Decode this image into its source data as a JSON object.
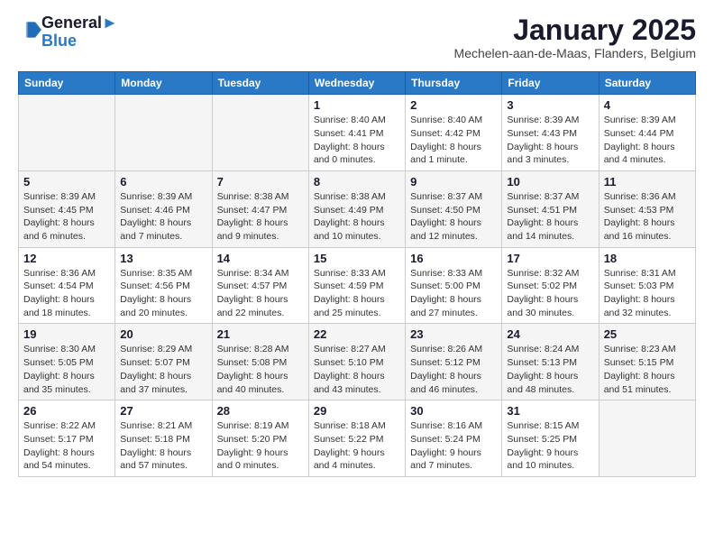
{
  "header": {
    "logo_line1": "General",
    "logo_line2": "Blue",
    "title": "January 2025",
    "subtitle": "Mechelen-aan-de-Maas, Flanders, Belgium"
  },
  "columns": [
    "Sunday",
    "Monday",
    "Tuesday",
    "Wednesday",
    "Thursday",
    "Friday",
    "Saturday"
  ],
  "weeks": [
    [
      {
        "day": "",
        "info": ""
      },
      {
        "day": "",
        "info": ""
      },
      {
        "day": "",
        "info": ""
      },
      {
        "day": "1",
        "info": "Sunrise: 8:40 AM\nSunset: 4:41 PM\nDaylight: 8 hours\nand 0 minutes."
      },
      {
        "day": "2",
        "info": "Sunrise: 8:40 AM\nSunset: 4:42 PM\nDaylight: 8 hours\nand 1 minute."
      },
      {
        "day": "3",
        "info": "Sunrise: 8:39 AM\nSunset: 4:43 PM\nDaylight: 8 hours\nand 3 minutes."
      },
      {
        "day": "4",
        "info": "Sunrise: 8:39 AM\nSunset: 4:44 PM\nDaylight: 8 hours\nand 4 minutes."
      }
    ],
    [
      {
        "day": "5",
        "info": "Sunrise: 8:39 AM\nSunset: 4:45 PM\nDaylight: 8 hours\nand 6 minutes."
      },
      {
        "day": "6",
        "info": "Sunrise: 8:39 AM\nSunset: 4:46 PM\nDaylight: 8 hours\nand 7 minutes."
      },
      {
        "day": "7",
        "info": "Sunrise: 8:38 AM\nSunset: 4:47 PM\nDaylight: 8 hours\nand 9 minutes."
      },
      {
        "day": "8",
        "info": "Sunrise: 8:38 AM\nSunset: 4:49 PM\nDaylight: 8 hours\nand 10 minutes."
      },
      {
        "day": "9",
        "info": "Sunrise: 8:37 AM\nSunset: 4:50 PM\nDaylight: 8 hours\nand 12 minutes."
      },
      {
        "day": "10",
        "info": "Sunrise: 8:37 AM\nSunset: 4:51 PM\nDaylight: 8 hours\nand 14 minutes."
      },
      {
        "day": "11",
        "info": "Sunrise: 8:36 AM\nSunset: 4:53 PM\nDaylight: 8 hours\nand 16 minutes."
      }
    ],
    [
      {
        "day": "12",
        "info": "Sunrise: 8:36 AM\nSunset: 4:54 PM\nDaylight: 8 hours\nand 18 minutes."
      },
      {
        "day": "13",
        "info": "Sunrise: 8:35 AM\nSunset: 4:56 PM\nDaylight: 8 hours\nand 20 minutes."
      },
      {
        "day": "14",
        "info": "Sunrise: 8:34 AM\nSunset: 4:57 PM\nDaylight: 8 hours\nand 22 minutes."
      },
      {
        "day": "15",
        "info": "Sunrise: 8:33 AM\nSunset: 4:59 PM\nDaylight: 8 hours\nand 25 minutes."
      },
      {
        "day": "16",
        "info": "Sunrise: 8:33 AM\nSunset: 5:00 PM\nDaylight: 8 hours\nand 27 minutes."
      },
      {
        "day": "17",
        "info": "Sunrise: 8:32 AM\nSunset: 5:02 PM\nDaylight: 8 hours\nand 30 minutes."
      },
      {
        "day": "18",
        "info": "Sunrise: 8:31 AM\nSunset: 5:03 PM\nDaylight: 8 hours\nand 32 minutes."
      }
    ],
    [
      {
        "day": "19",
        "info": "Sunrise: 8:30 AM\nSunset: 5:05 PM\nDaylight: 8 hours\nand 35 minutes."
      },
      {
        "day": "20",
        "info": "Sunrise: 8:29 AM\nSunset: 5:07 PM\nDaylight: 8 hours\nand 37 minutes."
      },
      {
        "day": "21",
        "info": "Sunrise: 8:28 AM\nSunset: 5:08 PM\nDaylight: 8 hours\nand 40 minutes."
      },
      {
        "day": "22",
        "info": "Sunrise: 8:27 AM\nSunset: 5:10 PM\nDaylight: 8 hours\nand 43 minutes."
      },
      {
        "day": "23",
        "info": "Sunrise: 8:26 AM\nSunset: 5:12 PM\nDaylight: 8 hours\nand 46 minutes."
      },
      {
        "day": "24",
        "info": "Sunrise: 8:24 AM\nSunset: 5:13 PM\nDaylight: 8 hours\nand 48 minutes."
      },
      {
        "day": "25",
        "info": "Sunrise: 8:23 AM\nSunset: 5:15 PM\nDaylight: 8 hours\nand 51 minutes."
      }
    ],
    [
      {
        "day": "26",
        "info": "Sunrise: 8:22 AM\nSunset: 5:17 PM\nDaylight: 8 hours\nand 54 minutes."
      },
      {
        "day": "27",
        "info": "Sunrise: 8:21 AM\nSunset: 5:18 PM\nDaylight: 8 hours\nand 57 minutes."
      },
      {
        "day": "28",
        "info": "Sunrise: 8:19 AM\nSunset: 5:20 PM\nDaylight: 9 hours\nand 0 minutes."
      },
      {
        "day": "29",
        "info": "Sunrise: 8:18 AM\nSunset: 5:22 PM\nDaylight: 9 hours\nand 4 minutes."
      },
      {
        "day": "30",
        "info": "Sunrise: 8:16 AM\nSunset: 5:24 PM\nDaylight: 9 hours\nand 7 minutes."
      },
      {
        "day": "31",
        "info": "Sunrise: 8:15 AM\nSunset: 5:25 PM\nDaylight: 9 hours\nand 10 minutes."
      },
      {
        "day": "",
        "info": ""
      }
    ]
  ]
}
